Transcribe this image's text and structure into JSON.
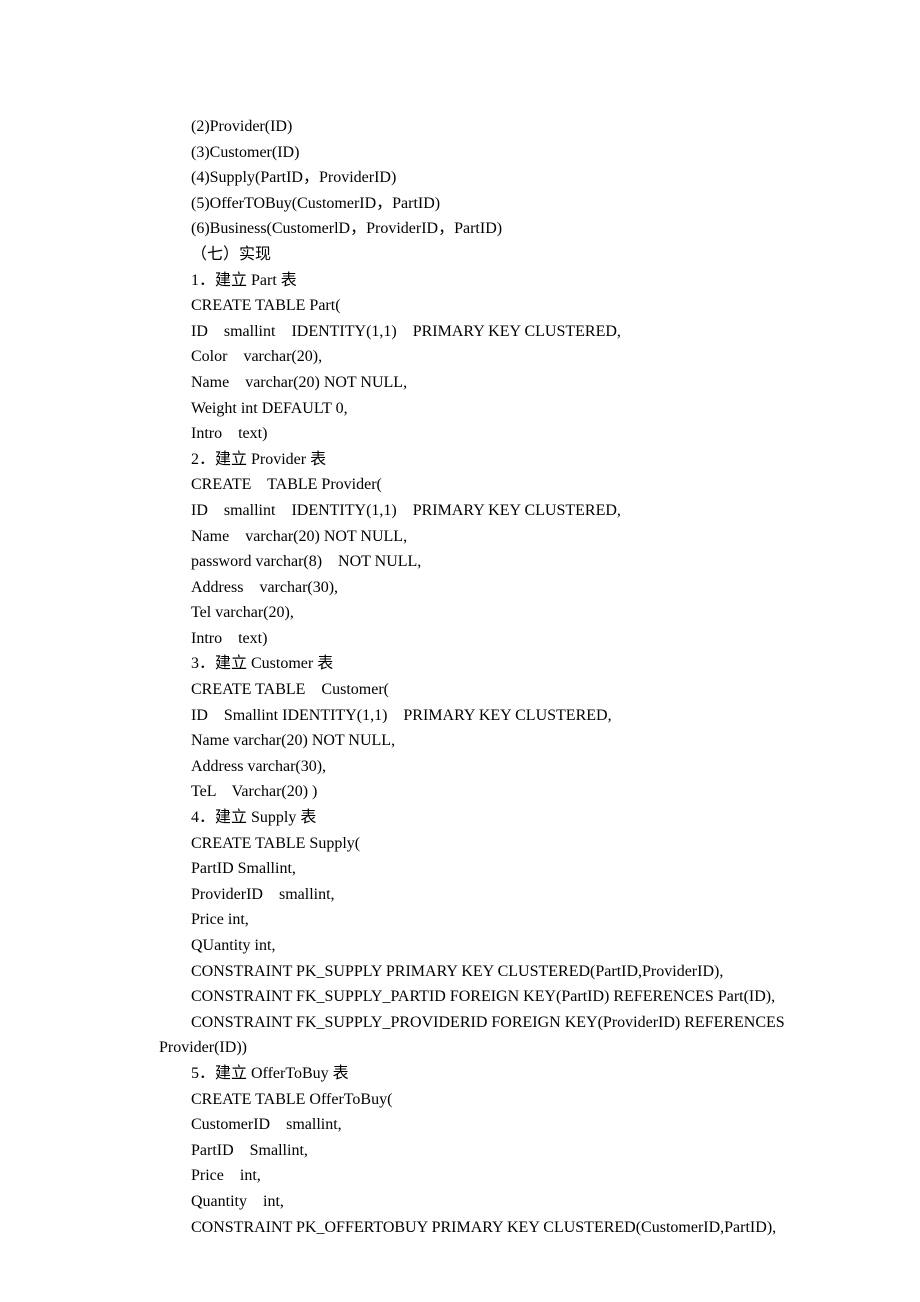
{
  "lines": [
    {
      "cls": "indent1",
      "t": "(2)Provider(ID)"
    },
    {
      "cls": "indent1",
      "t": "(3)Customer(ID)"
    },
    {
      "cls": "indent1",
      "t": "(4)Supply(PartID，ProviderID)"
    },
    {
      "cls": "indent1",
      "t": "(5)OfferTOBuy(CustomerID，PartID)"
    },
    {
      "cls": "indent1",
      "t": "(6)Business(CustomerlD，ProviderID，PartID)"
    },
    {
      "cls": "indent1",
      "t": "（七）实现"
    },
    {
      "cls": "indent1",
      "t": "1．建立 Part 表"
    },
    {
      "cls": "indent1",
      "t": "CREATE TABLE Part("
    },
    {
      "cls": "indent1",
      "t": "ID    smallint    IDENTITY(1,1)    PRIMARY KEY CLUSTERED,"
    },
    {
      "cls": "indent1",
      "t": "Color    varchar(20),"
    },
    {
      "cls": "indent1",
      "t": "Name    varchar(20) NOT NULL,"
    },
    {
      "cls": "indent1",
      "t": "Weight int DEFAULT 0,"
    },
    {
      "cls": "indent1",
      "t": "Intro    text)"
    },
    {
      "cls": "indent1",
      "t": "2．建立 Provider 表"
    },
    {
      "cls": "indent1",
      "t": "CREATE    TABLE Provider("
    },
    {
      "cls": "indent1",
      "t": "ID    smallint    IDENTITY(1,1)    PRIMARY KEY CLUSTERED,"
    },
    {
      "cls": "indent1",
      "t": "Name    varchar(20) NOT NULL,"
    },
    {
      "cls": "indent1",
      "t": "password varchar(8)    NOT NULL,"
    },
    {
      "cls": "indent1",
      "t": "Address    varchar(30),"
    },
    {
      "cls": "indent1",
      "t": "Tel varchar(20),"
    },
    {
      "cls": "indent1",
      "t": "Intro    text)"
    },
    {
      "cls": "indent1",
      "t": "3．建立 Customer 表"
    },
    {
      "cls": "indent1",
      "t": "CREATE TABLE    Customer("
    },
    {
      "cls": "indent1",
      "t": "ID    Smallint IDENTITY(1,1)    PRIMARY KEY CLUSTERED,"
    },
    {
      "cls": "indent1",
      "t": "Name varchar(20) NOT NULL,"
    },
    {
      "cls": "indent1",
      "t": "Address varchar(30),"
    },
    {
      "cls": "indent1",
      "t": "TeL    Varchar(20) )"
    },
    {
      "cls": "indent1",
      "t": "4．建立 Supply 表"
    },
    {
      "cls": "indent1",
      "t": "CREATE TABLE Supply("
    },
    {
      "cls": "indent1",
      "t": "PartID Smallint,"
    },
    {
      "cls": "indent1",
      "t": "ProviderID    smallint,"
    },
    {
      "cls": "indent1",
      "t": "Price int,"
    },
    {
      "cls": "indent1",
      "t": "QUantity int,"
    },
    {
      "cls": "indent1",
      "t": "CONSTRAINT PK_SUPPLY PRIMARY KEY CLUSTERED(PartID,ProviderID),"
    },
    {
      "cls": "indent1",
      "t": "CONSTRAINT FK_SUPPLY_PARTID FOREIGN KEY(PartID) REFERENCES Part(ID),"
    },
    {
      "cls": "indent1",
      "t": "CONSTRAINT FK_SUPPLY_PROVIDERID FOREIGN KEY(ProviderID) REFERENCES "
    },
    {
      "cls": "indent0",
      "t": "Provider(ID))"
    },
    {
      "cls": "indent1",
      "t": "5．建立 OfferToBuy 表"
    },
    {
      "cls": "indent1",
      "t": "CREATE TABLE OfferToBuy("
    },
    {
      "cls": "indent1",
      "t": "CustomerID    smallint,"
    },
    {
      "cls": "indent1",
      "t": "PartID    Smallint,"
    },
    {
      "cls": "indent1",
      "t": "Price    int,"
    },
    {
      "cls": "indent1",
      "t": "Quantity    int,"
    },
    {
      "cls": "indent1",
      "t": "CONSTRAINT PK_OFFERTOBUY PRIMARY KEY CLUSTERED(CustomerID,PartID),"
    }
  ]
}
